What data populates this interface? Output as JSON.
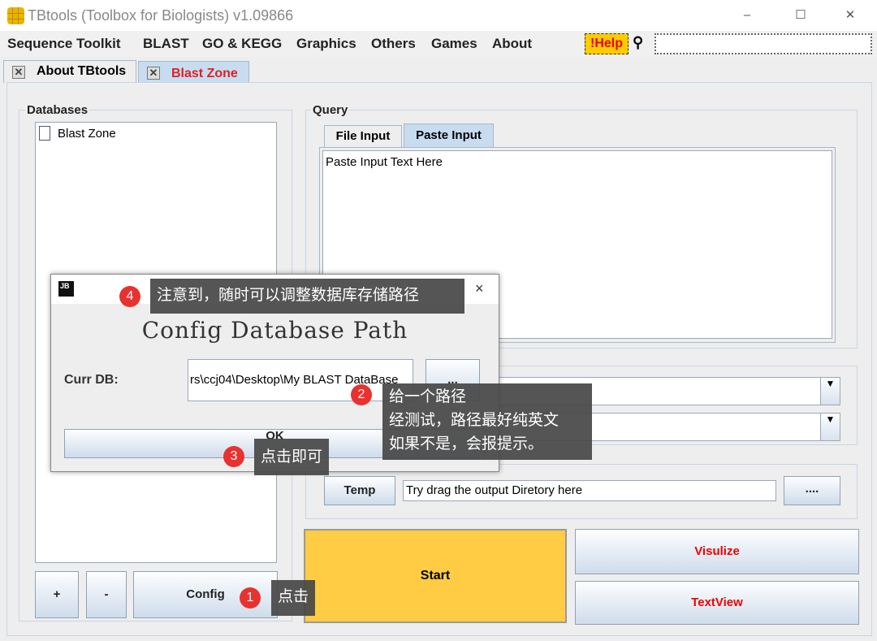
{
  "window": {
    "title": "TBtools (Toolbox for Biologists) v1.09866",
    "minimize": "–",
    "maximize": "☐",
    "close": "✕"
  },
  "menu": [
    "Sequence Toolkit",
    "BLAST",
    "GO & KEGG",
    "Graphics",
    "Others",
    "Games",
    "About"
  ],
  "help_label": "!Help",
  "tabs": [
    {
      "label": "About TBtools"
    },
    {
      "label": "Blast Zone",
      "active": true,
      "color": "#e02020"
    }
  ],
  "databases": {
    "title": "Databases",
    "items": [
      "Blast Zone"
    ],
    "add": "+",
    "remove": "-",
    "config": "Config"
  },
  "query": {
    "title": "Query",
    "tabs": [
      "File Input",
      "Paste Input"
    ],
    "text": "Paste Input Text Here"
  },
  "output": {
    "temp": "Temp",
    "placeholder": "Try drag the output Diretory here",
    "browse": "...."
  },
  "actions": {
    "start": "Start",
    "visualize": "Visulize",
    "textview": "TextView",
    "start_color": "#ffcc44",
    "action_color": "#e00000"
  },
  "dialog": {
    "icon": "JB",
    "close": "×",
    "title": "Config Database Path",
    "curr_label": "Curr DB:",
    "curr_value": "rs\\ccj04\\Desktop\\My BLAST DataBase",
    "browse": "...",
    "ok": "OK"
  },
  "annotations": [
    {
      "num": "1",
      "text": "点击"
    },
    {
      "num": "2",
      "lines": [
        "给一个路径",
        "经测试，路径最好纯英文",
        "如果不是，会报提示。"
      ]
    },
    {
      "num": "3",
      "text": "点击即可"
    },
    {
      "num": "4",
      "text": "注意到，随时可以调整数据库存储路径"
    }
  ]
}
